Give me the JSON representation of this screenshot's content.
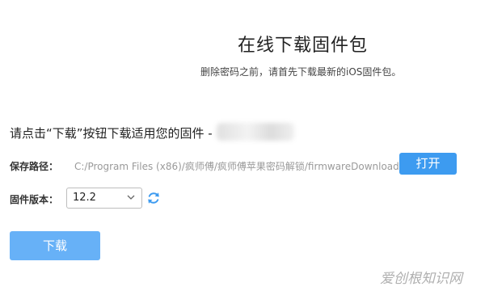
{
  "header": {
    "title": "在线下载固件包",
    "subtitle": "删除密码之前，请首先下载最新的iOS固件包。"
  },
  "prompt": {
    "text": "请点击“下载”按钮下载适用您的固件 -"
  },
  "save_path": {
    "label": "保存路径：",
    "value": "C:/Program Files (x86)/疯师傅/疯师傅苹果密码解锁/firmwareDownload",
    "open_label": "打开"
  },
  "firmware_version": {
    "label": "固件版本：",
    "selected": "12.2"
  },
  "download_label": "下载",
  "watermark": "爱创根知识网",
  "colors": {
    "open_button": "#3d9bf0",
    "download_button": "#67b1f7",
    "refresh_icon": "#3d9bf0"
  }
}
